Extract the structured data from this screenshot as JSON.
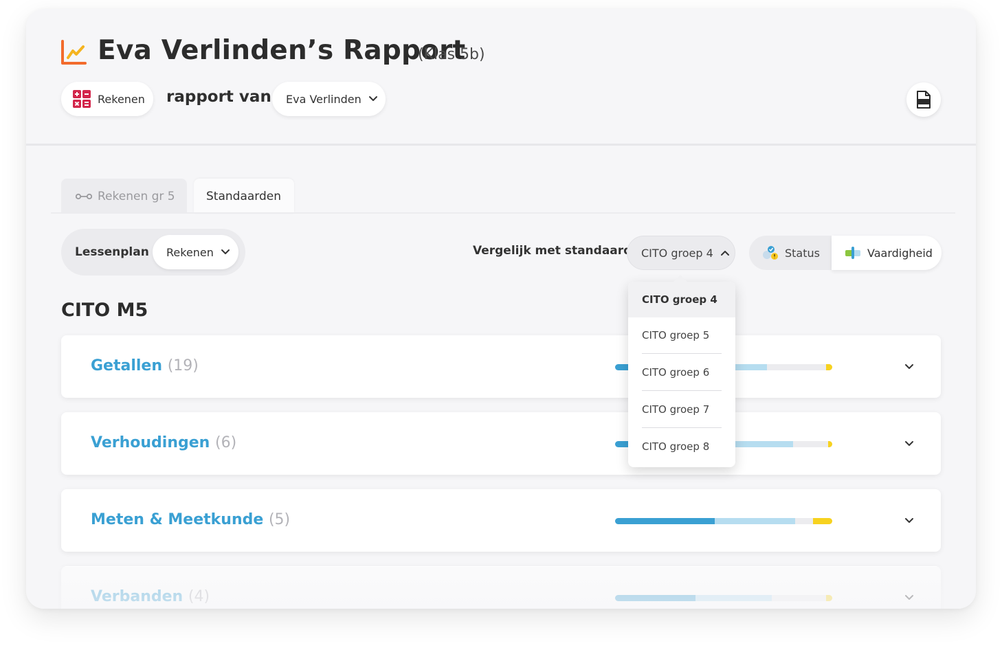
{
  "header": {
    "title": "Eva Verlinden’s Rapport",
    "subtitle": "(Klas 5b)",
    "subject_label": "Rekenen",
    "rapport_van": "rapport van",
    "student": "Eva Verlinden",
    "pdf_icon": "pdf-icon",
    "title_icon": "chart-line-icon"
  },
  "tabs": [
    {
      "label": "Rekenen gr 5",
      "active": false
    },
    {
      "label": "Standaarden",
      "active": true
    }
  ],
  "controls": {
    "lessenplan_label": "Lessenplan",
    "lessenplan_value": "Rekenen",
    "compare_label": "Vergelijk met standaard",
    "standard_value": "CITO groep 4",
    "toggle": {
      "status": "Status",
      "vaardigheid": "Vaardigheid",
      "active": "Vaardigheid"
    }
  },
  "standard_dropdown": {
    "open": true,
    "selected": "CITO groep 4",
    "options": [
      "CITO groep 4",
      "CITO groep 5",
      "CITO groep 6",
      "CITO groep 7",
      "CITO groep 8"
    ]
  },
  "section_title": "CITO M5",
  "domains": [
    {
      "name": "Getallen",
      "count": "(19)",
      "segments": [
        0.15,
        0.55,
        0.27,
        0.03
      ]
    },
    {
      "name": "Verhoudingen",
      "count": "(6)",
      "segments": [
        0.2,
        0.62,
        0.16,
        0.02
      ]
    },
    {
      "name": "Meten & Meetkunde",
      "count": "(5)",
      "segments": [
        0.46,
        0.37,
        0.08,
        0.09
      ]
    },
    {
      "name": "Verbanden",
      "count": "(4)",
      "segments": [
        0.37,
        0.35,
        0.25,
        0.03
      ]
    }
  ],
  "colors": {
    "accent": "#3aa0d3",
    "accent_light": "#b6ddf0",
    "warning": "#f7d21f",
    "title_icon": "#f26b2c"
  }
}
